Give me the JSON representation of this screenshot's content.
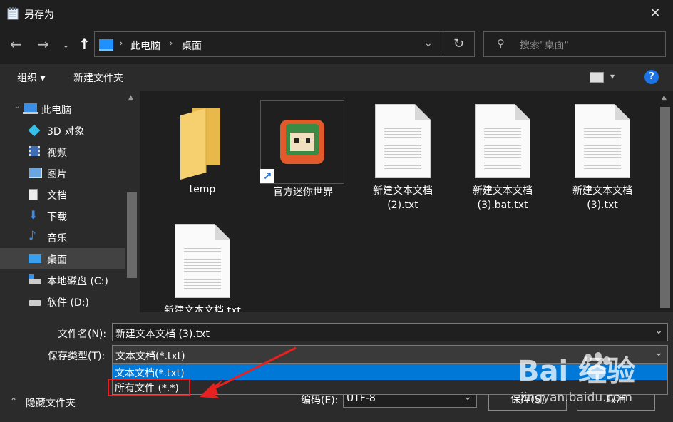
{
  "window": {
    "title": "另存为"
  },
  "nav": {
    "breadcrumb": [
      "此电脑",
      "桌面"
    ],
    "search_placeholder": "搜索\"桌面\""
  },
  "toolbar": {
    "organize": "组织 ▾",
    "new_folder": "新建文件夹",
    "help": "?"
  },
  "sidebar": {
    "items": [
      {
        "label": "此电脑",
        "icon": "computer-icon"
      },
      {
        "label": "3D 对象",
        "icon": "3d-objects-icon"
      },
      {
        "label": "视频",
        "icon": "video-icon"
      },
      {
        "label": "图片",
        "icon": "pictures-icon"
      },
      {
        "label": "文档",
        "icon": "documents-icon"
      },
      {
        "label": "下载",
        "icon": "download-icon"
      },
      {
        "label": "音乐",
        "icon": "music-icon"
      },
      {
        "label": "桌面",
        "icon": "desktop-icon",
        "selected": true
      },
      {
        "label": "本地磁盘 (C:)",
        "icon": "drive-icon"
      },
      {
        "label": "软件 (D:)",
        "icon": "drive-icon"
      }
    ]
  },
  "files": [
    {
      "name": "temp",
      "type": "folder"
    },
    {
      "name": "官方迷你世界",
      "type": "shortcut"
    },
    {
      "name": "新建文本文档\n(2).txt",
      "type": "document"
    },
    {
      "name": "新建文本文档\n(3).bat.txt",
      "type": "document"
    },
    {
      "name": "新建文本文档\n(3).txt",
      "type": "document"
    },
    {
      "name": "新建文本文档.txt",
      "type": "document"
    }
  ],
  "form": {
    "filename_label": "文件名(N):",
    "filename_value": "新建文本文档 (3).txt",
    "filetype_label": "保存类型(T):",
    "filetype_value": "文本文档(*.txt)",
    "filetype_options": [
      "文本文档(*.txt)",
      "所有文件  (*.*)"
    ],
    "encoding_label": "编码(E):",
    "encoding_value": "UTF-8",
    "hide_folders": "隐藏文件夹",
    "save_button": "保存(S)",
    "cancel_button": "取消"
  },
  "watermark": {
    "brand": "Bai  经验",
    "url": "jingyan.baidu.com"
  },
  "colors": {
    "accent": "#0078d7",
    "highlight": "#e82020",
    "folder": "#f3c862"
  }
}
